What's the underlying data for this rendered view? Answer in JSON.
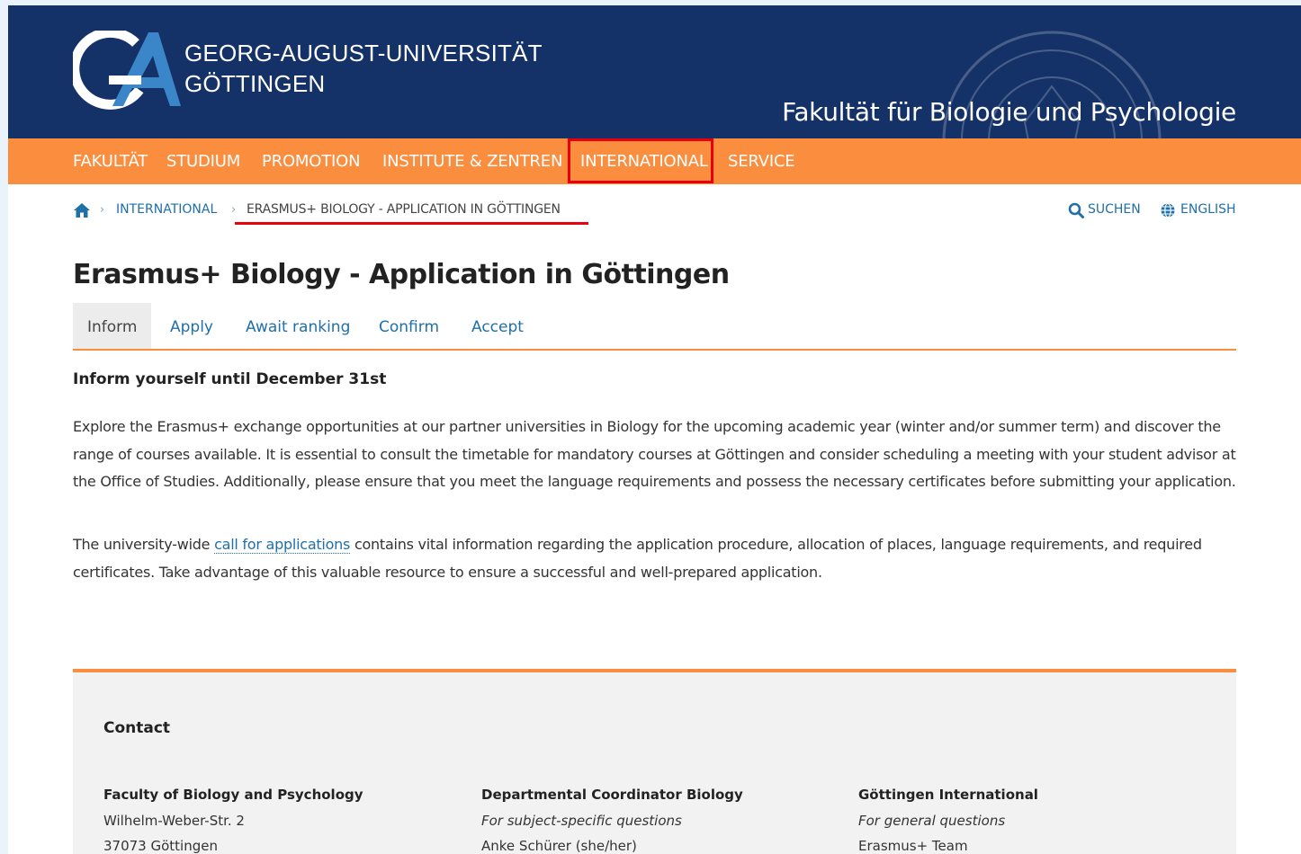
{
  "header": {
    "university_line1": "GEORG-AUGUST-UNIVERSITÄT",
    "university_line2": "GÖTTINGEN",
    "faculty": "Fakultät für Biologie und Psychologie",
    "brand_color": "#153268"
  },
  "nav": {
    "accent_color": "#fb8d3e",
    "items": [
      "FAKULTÄT",
      "STUDIUM",
      "PROMOTION",
      "INSTITUTE & ZENTREN",
      "INTERNATIONAL",
      "SERVICE"
    ],
    "highlighted": "INTERNATIONAL"
  },
  "breadcrumb": {
    "home_icon": "home-icon",
    "items": [
      "INTERNATIONAL",
      "ERASMUS+ BIOLOGY - APPLICATION IN GÖTTINGEN"
    ]
  },
  "utility": {
    "search_label": "SUCHEN",
    "search_icon": "search-icon",
    "language_label": "ENGLISH",
    "language_icon": "globe-icon"
  },
  "page": {
    "title": "Erasmus+ Biology - Application in Göttingen"
  },
  "tabs": {
    "items": [
      "Inform",
      "Apply",
      "Await ranking",
      "Confirm",
      "Accept"
    ],
    "active": "Inform"
  },
  "content": {
    "heading": "Inform yourself until December 31st",
    "para1": "Explore the Erasmus+ exchange opportunities at our partner universities in Biology for the upcoming academic year (winter and/or summer term) and discover the range of courses available. It is essential to consult the timetable for mandatory courses at Göttingen and consider scheduling a meeting with your student advisor at the Office of Studies. Additionally, please ensure that you meet the language requirements and possess the necessary certificates before submitting your application.",
    "para2_before": "The university-wide ",
    "para2_link": "call for applications",
    "para2_after": " contains vital information regarding the application procedure, allocation of places, language requirements, and required certificates. Take advantage of this valuable resource to ensure a successful and well-prepared application."
  },
  "contact": {
    "heading": "Contact",
    "columns": [
      {
        "title": "Faculty of Biology and Psychology",
        "line2": "Wilhelm-Weber-Str. 2",
        "line3": "37073 Göttingen"
      },
      {
        "title": "Departmental Coordinator Biology",
        "line2": "For subject-specific questions",
        "line3": "Anke Schürer (she/her)"
      },
      {
        "title": "Göttingen International",
        "line2": "For general questions",
        "line3": "Erasmus+ Team"
      }
    ]
  }
}
